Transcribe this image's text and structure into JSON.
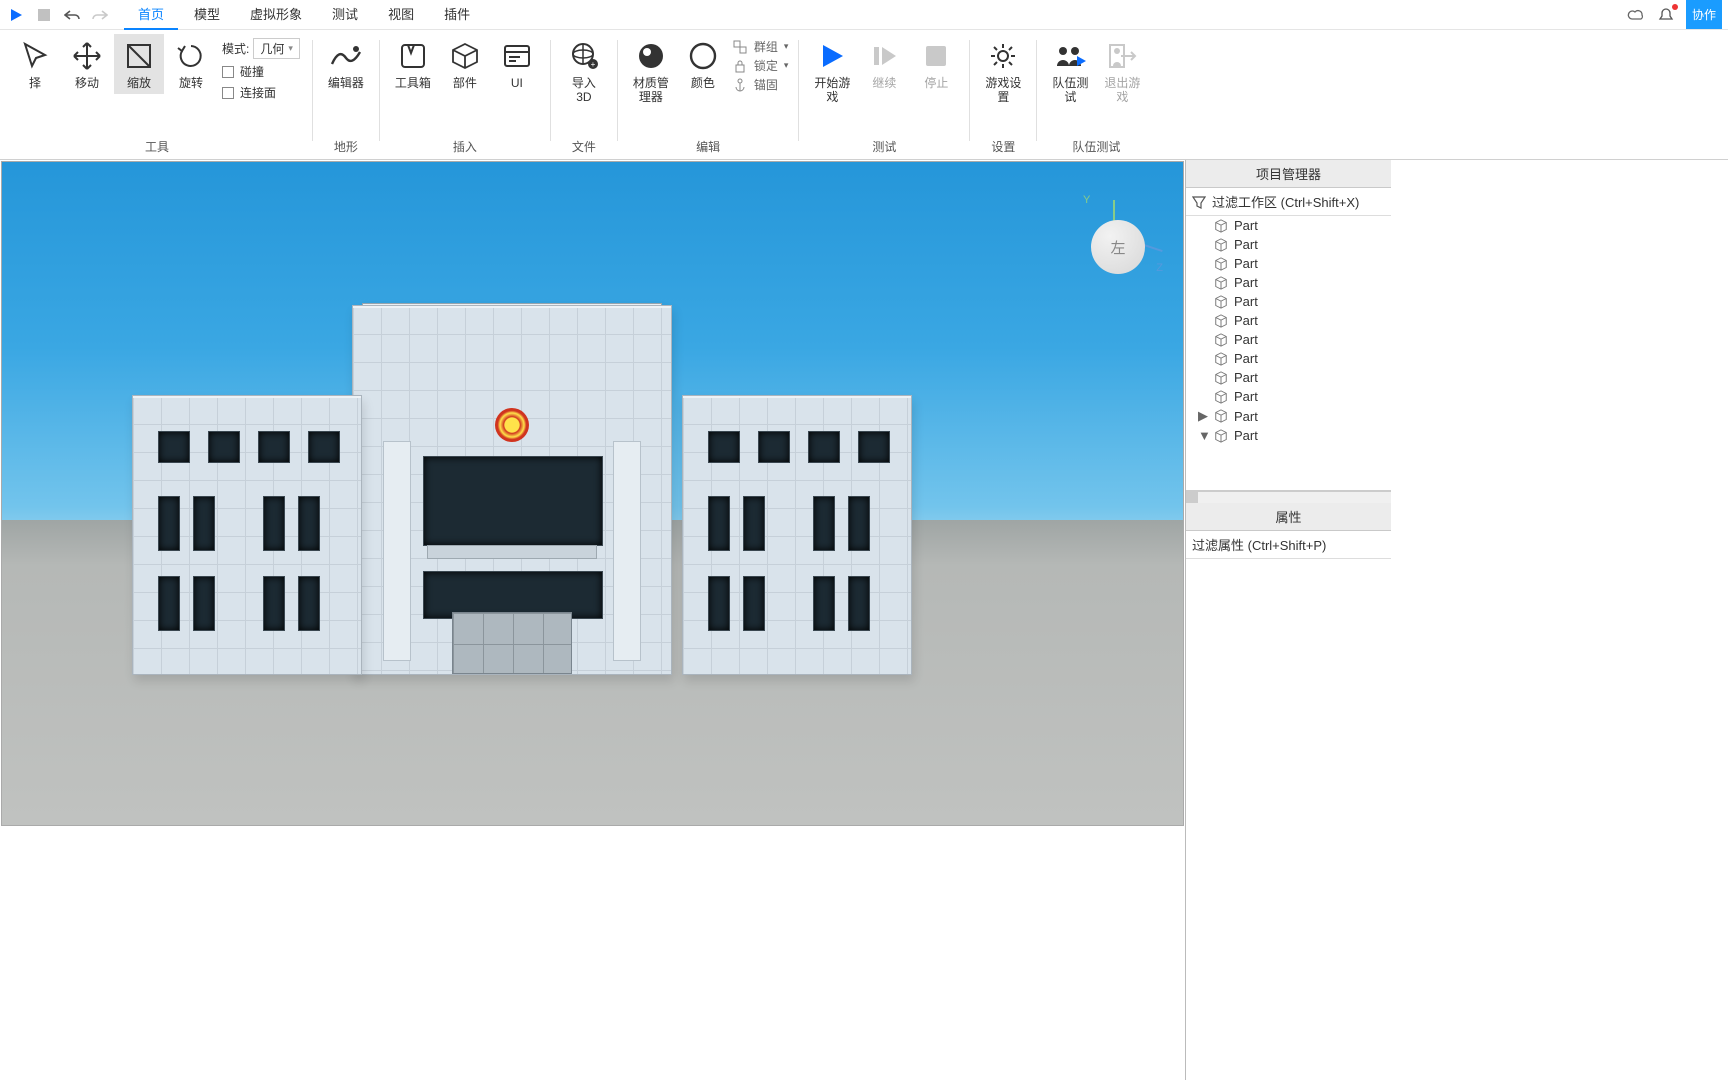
{
  "tabs": [
    "首页",
    "模型",
    "虚拟形象",
    "测试",
    "视图",
    "插件"
  ],
  "active_tab": 0,
  "qa_right": {
    "collab": "协作"
  },
  "ribbon": {
    "tools": {
      "group": "工具",
      "select": "择",
      "move": "移动",
      "scale": "缩放",
      "rotate": "旋转"
    },
    "mode": {
      "label": "模式:",
      "value": "几何",
      "collision": "碰撞",
      "join": "连接面"
    },
    "terrain": {
      "group": "地形",
      "editor": "编辑器"
    },
    "insert": {
      "group": "插入",
      "toolbox": "工具箱",
      "part": "部件",
      "ui": "UI"
    },
    "file": {
      "group": "文件",
      "import": "导入",
      "import2": "3D"
    },
    "edit": {
      "group": "编辑",
      "mat": "材质管理器",
      "color": "颜色",
      "grp": "群组",
      "lock": "锁定",
      "anchor": "锚固"
    },
    "test": {
      "group": "测试",
      "play": "开始游戏",
      "resume": "继续",
      "stop": "停止"
    },
    "settings": {
      "group": "设置",
      "game": "游戏设置"
    },
    "team": {
      "group": "队伍测试",
      "team": "队伍测试",
      "exit": "退出游戏"
    }
  },
  "gizmo": {
    "face": "左",
    "y": "Y",
    "z": "Z"
  },
  "explorer": {
    "title": "项目管理器",
    "filter": "过滤工作区 (Ctrl+Shift+X)",
    "items": [
      {
        "name": "Part"
      },
      {
        "name": "Part"
      },
      {
        "name": "Part"
      },
      {
        "name": "Part"
      },
      {
        "name": "Part"
      },
      {
        "name": "Part"
      },
      {
        "name": "Part"
      },
      {
        "name": "Part"
      },
      {
        "name": "Part"
      },
      {
        "name": "Part"
      },
      {
        "name": "Part",
        "caret": "▶"
      },
      {
        "name": "Part",
        "caret": "▼"
      }
    ]
  },
  "props": {
    "title": "属性",
    "filter": "过滤属性 (Ctrl+Shift+P)"
  }
}
